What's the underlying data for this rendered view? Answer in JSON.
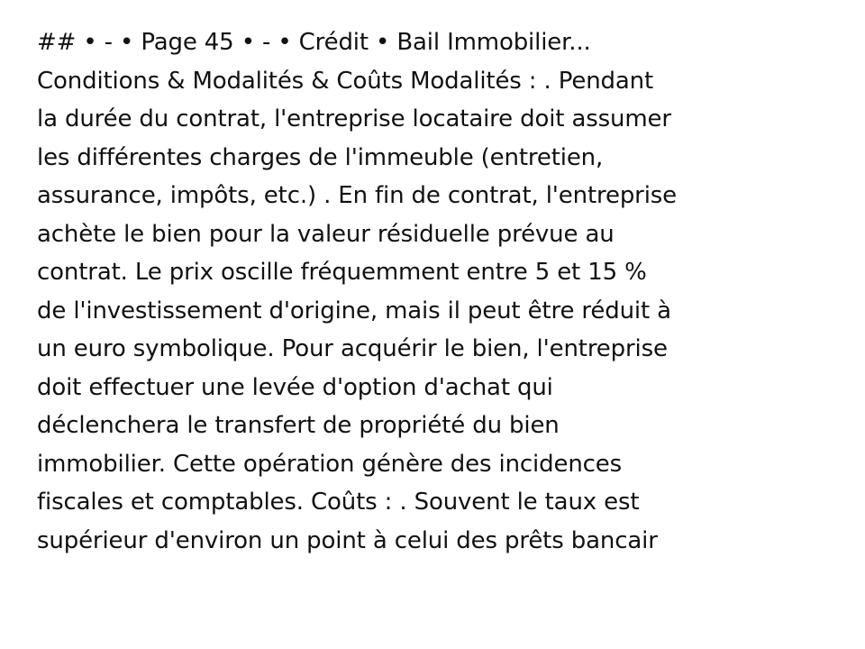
{
  "document": {
    "lines": [
      "## • - • Page 45 • - • Crédit • Bail Immobilier...",
      "Conditions & Modalités & Coûts Modalités : . Pendant",
      "la durée du contrat, l'entreprise locataire doit assumer",
      "les différentes charges de l'immeuble (entretien,",
      "assurance, impôts, etc.) . En fin de contrat, l'entreprise",
      "achète le bien pour la valeur résiduelle prévue au",
      "contrat. Le prix oscille fréquemment entre 5 et 15 %",
      "de l'investissement d'origine, mais il peut être réduit à",
      "un euro symbolique. Pour acquérir le bien, l'entreprise",
      "doit effectuer une levée d'option d'achat qui",
      "déclenchera le transfert de propriété du bien",
      "immobilier. Cette opération génère des incidences",
      "fiscales et comptables. Coûts : . Souvent le taux est",
      "supérieur d'environ un point à celui des prêts bancair"
    ],
    "text_color": "#111111",
    "background_color": "#ffffff"
  }
}
